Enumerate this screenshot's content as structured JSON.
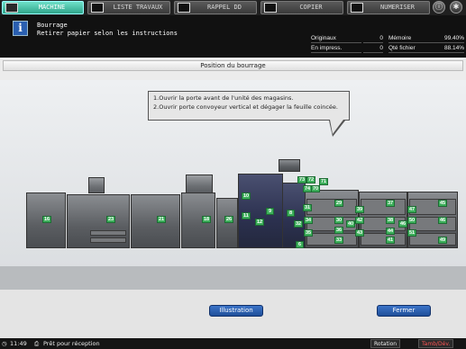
{
  "tabs": [
    {
      "label": "MACHINE",
      "active": true
    },
    {
      "label": "LISTE TRAVAUX",
      "active": false
    },
    {
      "label": "RAPPEL DD",
      "active": false
    },
    {
      "label": "COPIER",
      "active": false
    },
    {
      "label": "NUMERISER",
      "active": false
    }
  ],
  "header": {
    "title": "Bourrage",
    "subtitle": "Retirer papier selon les instructions"
  },
  "counters": {
    "originaux_label": "Originaux",
    "originaux_value": "0",
    "memoire_label": "Mémoire",
    "memoire_value": "99.40%",
    "impress_label": "En impress.",
    "impress_value": "0",
    "fichier_label": "Qté fichier",
    "fichier_value": "88.14%"
  },
  "main": {
    "section_title": "Position du bourrage",
    "instruction_line1": "1.Ouvrir la porte avant de l'unité des magasins.",
    "instruction_line2": "2.Ouvrir porte convoyeur vertical et dégager la feuille coincée."
  },
  "jam_tags": [
    "16",
    "23",
    "21",
    "18",
    "26",
    "10",
    "11",
    "12",
    "9",
    "8",
    "6",
    "73",
    "72",
    "74",
    "70",
    "71",
    "31",
    "32",
    "34",
    "35",
    "36",
    "33",
    "29",
    "30",
    "40",
    "42",
    "43",
    "38",
    "39",
    "37",
    "41",
    "44",
    "46",
    "50",
    "51",
    "47",
    "45",
    "46",
    "49"
  ],
  "buttons": {
    "illustration": "Illustration",
    "fermer": "Fermer"
  },
  "status": {
    "time": "11:49",
    "message": "Prêt pour réception",
    "rotation": "Rotation",
    "tamb": "Tamb/Dév."
  },
  "colors": {
    "accent": "#2fa58b",
    "tag": "#3cae5a",
    "button": "#1f4f9a"
  }
}
